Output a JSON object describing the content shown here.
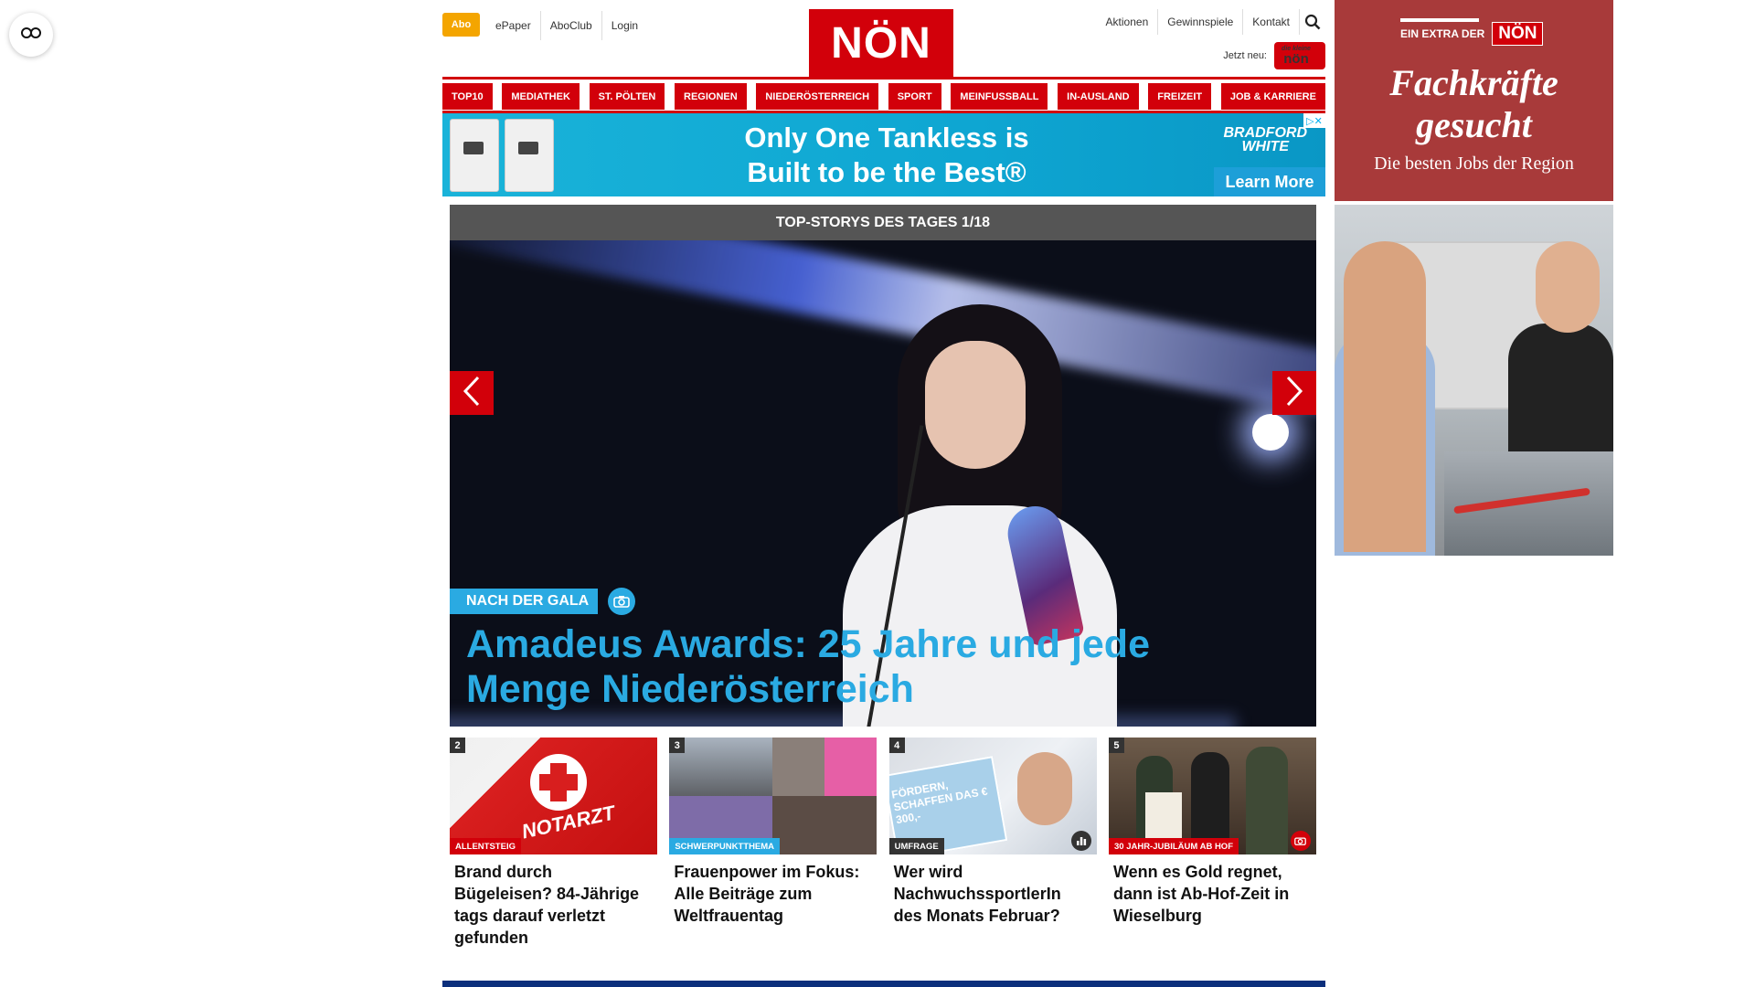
{
  "toggle": {
    "icon": "glasses-icon"
  },
  "header": {
    "abo_label": "Abo",
    "top_links": [
      "ePaper",
      "AboClub",
      "Login"
    ],
    "logo": "NÖN",
    "right_links": [
      "Aktionen",
      "Gewinnspiele",
      "Kontakt"
    ],
    "jetzt_label": "Jetzt neu:",
    "jetzt_badge_top": "die kleine",
    "jetzt_badge_bottom": "nön"
  },
  "nav": {
    "items": [
      "TOP10",
      "MEDIATHEK",
      "ST. PÖLTEN",
      "REGIONEN",
      "NIEDERÖSTERREICH",
      "SPORT",
      "MEINFUSSBALL",
      "IN-AUSLAND",
      "FREIZEIT",
      "JOB & KARRIERE"
    ]
  },
  "banner": {
    "line1": "Only One Tankless is",
    "line2": "Built to be the Best®",
    "brand_line1": "BRADFORD",
    "brand_line2": "WHITE",
    "cta": "Learn More",
    "adchoice": "▷✕"
  },
  "topstory": {
    "header": "TOP-STORYS DES TAGES 1/18",
    "tag": "NACH DER GALA",
    "title": "Amadeus Awards: 25 Jahre und jede Menge Niederösterreich"
  },
  "cards": [
    {
      "num": "2",
      "tag": "ALLENTSTEIG",
      "title": "Brand durch Bügeleisen? 84-Jährige tags darauf verletzt gefunden",
      "img_text": "NOTARZT"
    },
    {
      "num": "3",
      "tag": "SCHWERPUNKTTHEMA",
      "title": "Frauenpower im Fokus: Alle Beiträge zum Weltfrauentag"
    },
    {
      "num": "4",
      "tag": "UMFRAGE",
      "title": "Wer wird NachwuchssportlerIn des Monats Februar?",
      "img_text": "FÖRDERN, SCHAFFEN DAS € 300,-"
    },
    {
      "num": "5",
      "tag": "30 JAHR-JUBILÄUM AB HOF",
      "title": "Wenn es Gold regnet, dann ist Ab-Hof-Zeit in Wieselburg"
    }
  ],
  "side_ad": {
    "extra_label": "EIN EXTRA DER",
    "extra_logo": "NÖN",
    "headline_line1": "Fachkräfte",
    "headline_line2": "gesucht",
    "sub": "Die besten Jobs der Region"
  },
  "colors": {
    "brand_red": "#d2000a",
    "accent_blue": "#2aaae2",
    "abo_orange": "#f4a500",
    "side_ad_red": "#a83a3a",
    "footer_blue": "#0b2f7c"
  }
}
